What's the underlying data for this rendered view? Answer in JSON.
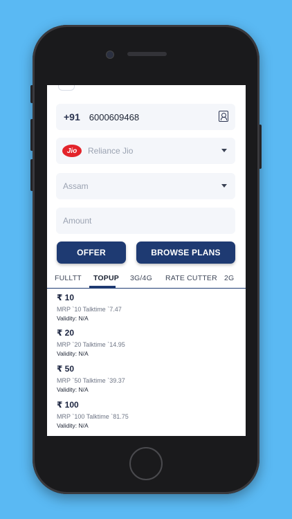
{
  "form": {
    "country_code": "+91",
    "mobile_number": "6000609468",
    "operator_logo_text": "Jio",
    "operator": "Reliance Jio",
    "state": "Assam",
    "amount_placeholder": "Amount"
  },
  "buttons": {
    "offer": "OFFER",
    "browse_plans": "BROWSE PLANS"
  },
  "tabs": [
    {
      "label": "FULLTT",
      "active": false
    },
    {
      "label": "TOPUP",
      "active": true
    },
    {
      "label": "3G/4G",
      "active": false
    },
    {
      "label": "RATE CUTTER",
      "active": false
    },
    {
      "label": "2G",
      "active": false
    }
  ],
  "plans": [
    {
      "price": "₹ 10",
      "description": "MRP `10 Talktime `7.47",
      "validity": "Validity: N/A"
    },
    {
      "price": "₹ 20",
      "description": "MRP `20 Talktime `14.95",
      "validity": "Validity: N/A"
    },
    {
      "price": "₹ 50",
      "description": "MRP `50 Talktime `39.37",
      "validity": "Validity: N/A"
    },
    {
      "price": "₹ 100",
      "description": "MRP `100 Talktime `81.75",
      "validity": "Validity: N/A"
    }
  ],
  "colors": {
    "background": "#5ab9f3",
    "primary": "#1e3a72",
    "jio_red": "#e3242b",
    "field_bg": "#f4f6fa"
  }
}
